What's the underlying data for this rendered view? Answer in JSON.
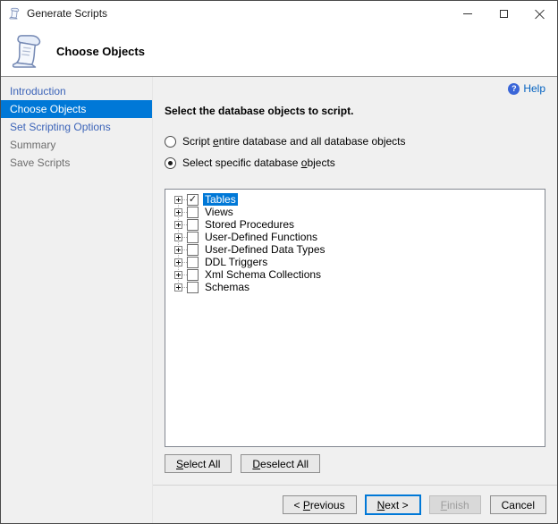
{
  "window": {
    "title": "Generate Scripts",
    "controls": {
      "minimize": "minimize",
      "maximize": "maximize",
      "close": "close"
    }
  },
  "header": {
    "title": "Choose Objects",
    "icon": "script-scroll-icon"
  },
  "help": {
    "label": "Help",
    "icon": "help-question-icon"
  },
  "sidebar": {
    "items": [
      {
        "label": "Introduction",
        "state": "link"
      },
      {
        "label": "Choose Objects",
        "state": "active"
      },
      {
        "label": "Set Scripting Options",
        "state": "link"
      },
      {
        "label": "Summary",
        "state": "disabled"
      },
      {
        "label": "Save Scripts",
        "state": "disabled"
      }
    ]
  },
  "main": {
    "instruction": "Select the database objects to script.",
    "radios": [
      {
        "pre": "Script ",
        "key": "e",
        "post": "ntire database and all database objects",
        "selected": false
      },
      {
        "pre": "Select specific database ",
        "key": "o",
        "post": "bjects",
        "selected": true
      }
    ],
    "tree": {
      "items": [
        {
          "label": "Tables",
          "checked": true,
          "selected": true
        },
        {
          "label": "Views",
          "checked": false,
          "selected": false
        },
        {
          "label": "Stored Procedures",
          "checked": false,
          "selected": false
        },
        {
          "label": "User-Defined Functions",
          "checked": false,
          "selected": false
        },
        {
          "label": "User-Defined Data Types",
          "checked": false,
          "selected": false
        },
        {
          "label": "DDL Triggers",
          "checked": false,
          "selected": false
        },
        {
          "label": "Xml Schema Collections",
          "checked": false,
          "selected": false
        },
        {
          "label": "Schemas",
          "checked": false,
          "selected": false
        }
      ]
    },
    "select_buttons": {
      "select_all": {
        "pre": "",
        "key": "S",
        "post": "elect All"
      },
      "deselect_all": {
        "pre": "",
        "key": "D",
        "post": "eselect All"
      }
    }
  },
  "footer": {
    "previous": {
      "pre": "< ",
      "key": "P",
      "post": "revious",
      "state": "normal"
    },
    "next": {
      "pre": "",
      "key": "N",
      "post": "ext >",
      "state": "default"
    },
    "finish": {
      "pre": "",
      "key": "F",
      "post": "inish",
      "state": "disabled"
    },
    "cancel": {
      "pre": "",
      "key": "",
      "post": "Cancel",
      "state": "normal"
    }
  },
  "colors": {
    "accent_blue": "#0078d7",
    "sidebar_link_blue": "#3b63b8",
    "help_blue": "#0563c1",
    "disabled_text": "#6d6d6d",
    "body_background": "#f0f0f0",
    "tree_background": "#ffffff"
  }
}
